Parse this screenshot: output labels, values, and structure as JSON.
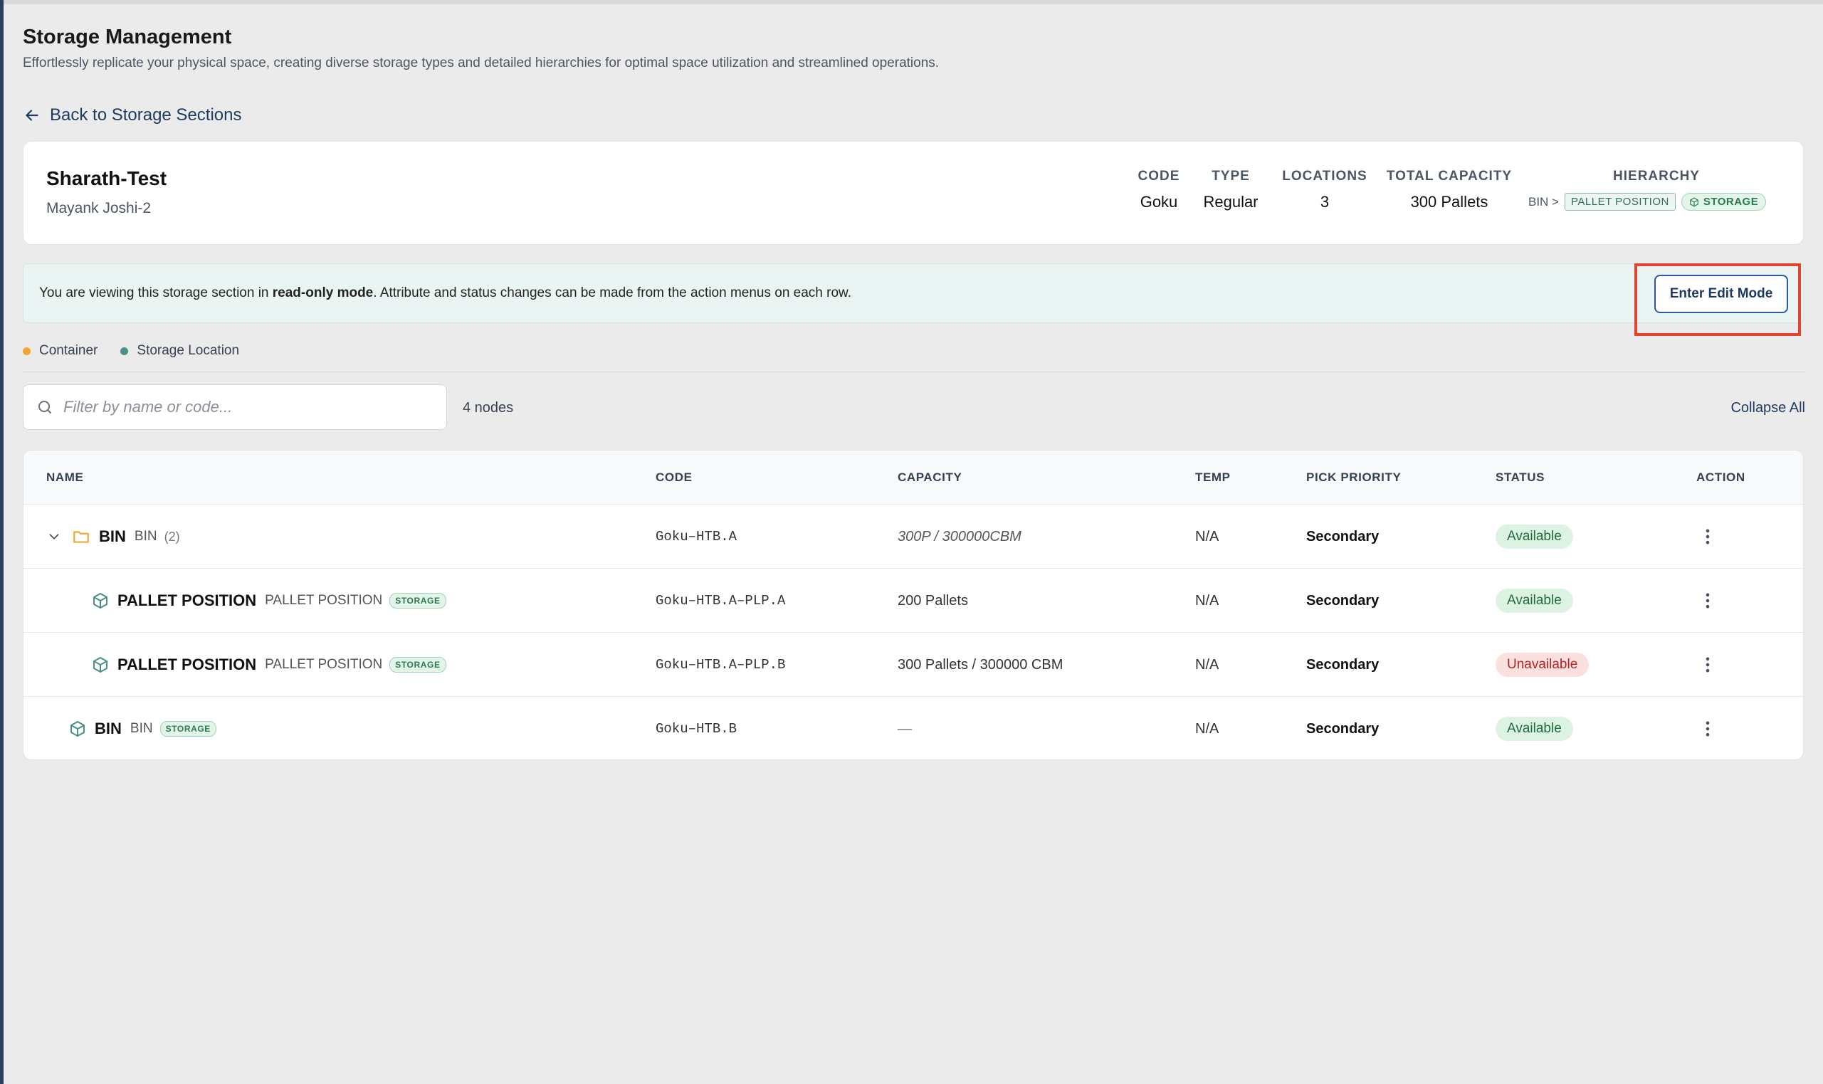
{
  "page": {
    "title": "Storage Management",
    "subtitle": "Effortlessly replicate your physical space, creating diverse storage types and detailed hierarchies for optimal space utilization and streamlined operations.",
    "back_label": "Back to Storage Sections"
  },
  "section": {
    "name": "Sharath-Test",
    "owner": "Mayank Joshi-2",
    "stats": {
      "code_label": "CODE",
      "code_value": "Goku",
      "type_label": "TYPE",
      "type_value": "Regular",
      "locations_label": "LOCATIONS",
      "locations_value": "3",
      "capacity_label": "TOTAL CAPACITY",
      "capacity_value": "300 Pallets",
      "hierarchy_label": "HIERARCHY",
      "hierarchy_root": "BIN >",
      "hierarchy_level": "PALLET POSITION",
      "hierarchy_storage": "STORAGE"
    }
  },
  "banner": {
    "text_before": "You are viewing this storage section in ",
    "text_bold": "read-only mode",
    "text_after": ". Attribute and status changes can be made from the action menus on each row.",
    "edit_button": "Enter Edit Mode"
  },
  "legend": {
    "container_label": "Container",
    "container_color": "#f0a832",
    "location_label": "Storage Location",
    "location_color": "#4a8f86"
  },
  "toolbar": {
    "search_placeholder": "Filter by name or code...",
    "node_count": "4 nodes",
    "collapse_all": "Collapse All"
  },
  "table": {
    "headers": {
      "name": "NAME",
      "code": "CODE",
      "capacity": "CAPACITY",
      "temp": "TEMP",
      "pick_priority": "PICK PRIORITY",
      "status": "STATUS",
      "action": "ACTION"
    },
    "rows": [
      {
        "name": "BIN",
        "type": "BIN",
        "count": "(2)",
        "tag": "",
        "code": "Goku–HTB.A",
        "capacity": "300P / 300000CBM",
        "temp": "N/A",
        "priority": "Secondary",
        "status": "Available"
      },
      {
        "name": "PALLET POSITION",
        "type": "PALLET POSITION",
        "count": "",
        "tag": "STORAGE",
        "code": "Goku–HTB.A–PLP.A",
        "capacity": "200 Pallets",
        "temp": "N/A",
        "priority": "Secondary",
        "status": "Available"
      },
      {
        "name": "PALLET POSITION",
        "type": "PALLET POSITION",
        "count": "",
        "tag": "STORAGE",
        "code": "Goku–HTB.A–PLP.B",
        "capacity": "300 Pallets / 300000 CBM",
        "temp": "N/A",
        "priority": "Secondary",
        "status": "Unavailable"
      },
      {
        "name": "BIN",
        "type": "BIN",
        "count": "",
        "tag": "STORAGE",
        "code": "Goku–HTB.B",
        "capacity": "—",
        "temp": "N/A",
        "priority": "Secondary",
        "status": "Available"
      }
    ]
  },
  "colors": {
    "accent": "#1e3a5f",
    "highlight_box": "#e2442f",
    "available_bg": "#dcf3e4",
    "unavailable_bg": "#fbe0e0"
  }
}
